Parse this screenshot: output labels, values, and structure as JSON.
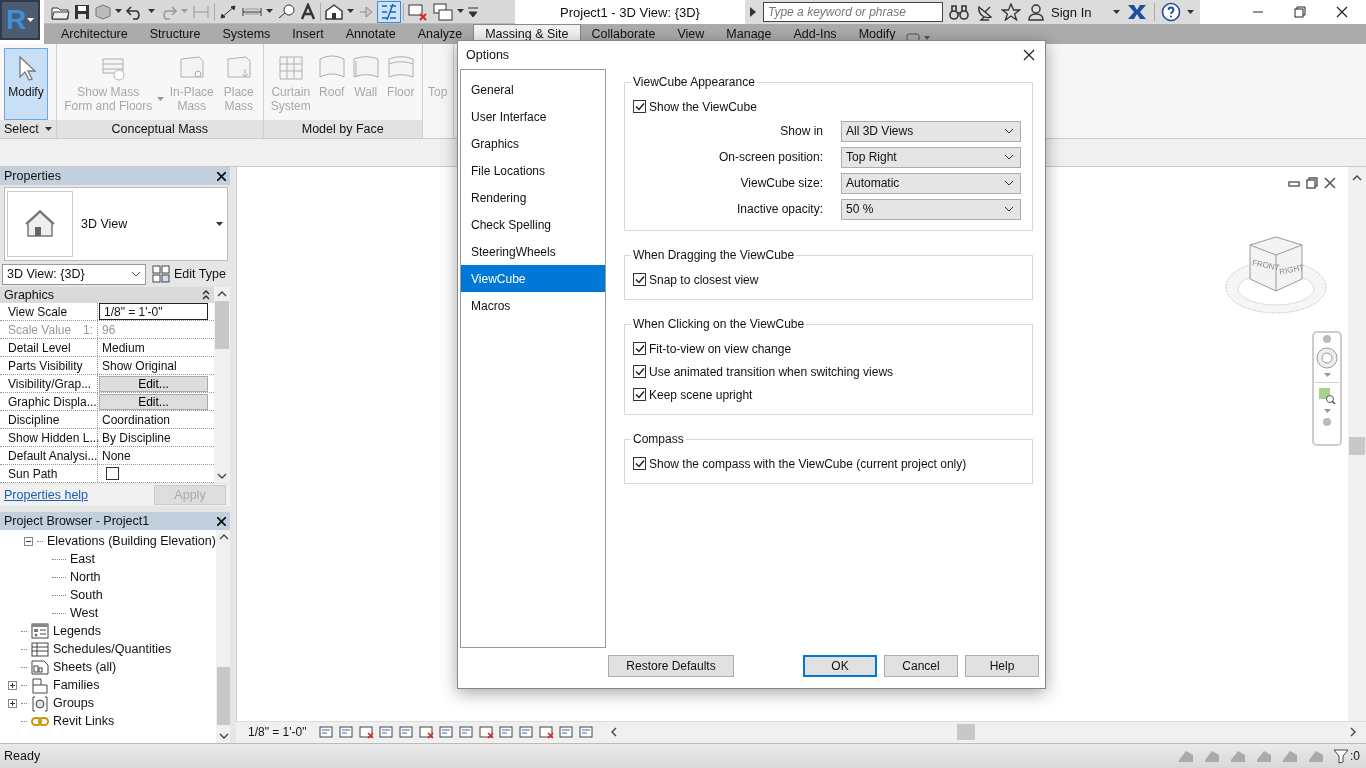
{
  "app_button": {
    "label": "R"
  },
  "window": {
    "title": "Project1 - 3D View: {3D}"
  },
  "search": {
    "placeholder": "Type a keyword or phrase"
  },
  "account": {
    "label": "Sign In"
  },
  "ribbon_tabs": [
    {
      "label": "Architecture",
      "selected": false
    },
    {
      "label": "Structure",
      "selected": false
    },
    {
      "label": "Systems",
      "selected": false
    },
    {
      "label": "Insert",
      "selected": false
    },
    {
      "label": "Annotate",
      "selected": false
    },
    {
      "label": "Analyze",
      "selected": false
    },
    {
      "label": "Massing & Site",
      "selected": true
    },
    {
      "label": "Collaborate",
      "selected": false
    },
    {
      "label": "View",
      "selected": false
    },
    {
      "label": "Manage",
      "selected": false
    },
    {
      "label": "Add-Ins",
      "selected": false
    },
    {
      "label": "Modify",
      "selected": false
    }
  ],
  "ribbon_panels": [
    {
      "label": "Select",
      "menu": true,
      "buttons": [
        {
          "label": "Modify",
          "selected": true,
          "disabled": false,
          "menu": false
        }
      ]
    },
    {
      "label": "Conceptual Mass",
      "menu": false,
      "buttons": [
        {
          "label": "Show Mass Form and Floors",
          "selected": false,
          "disabled": true,
          "menu": true
        },
        {
          "label": "In-Place Mass",
          "selected": false,
          "disabled": true,
          "menu": false
        },
        {
          "label": "Place Mass",
          "selected": false,
          "disabled": true,
          "menu": false
        }
      ]
    },
    {
      "label": "Model by Face",
      "menu": false,
      "buttons": [
        {
          "label": "Curtain System",
          "selected": false,
          "disabled": true,
          "menu": false
        },
        {
          "label": "Roof",
          "selected": false,
          "disabled": true,
          "menu": false
        },
        {
          "label": "Wall",
          "selected": false,
          "disabled": true,
          "menu": false
        },
        {
          "label": "Floor",
          "selected": false,
          "disabled": true,
          "menu": false
        }
      ]
    },
    {
      "buttons": [
        {
          "label": "Top",
          "selected": false,
          "disabled": true,
          "menu": false
        }
      ]
    }
  ],
  "properties": {
    "title": "Properties",
    "type_name": "3D View",
    "instance": "3D View: {3D}",
    "edit_type": "Edit Type",
    "group": {
      "label": "Graphics",
      "expanded": true
    },
    "rows": [
      {
        "kind": "input",
        "label": "View Scale",
        "value": "1/8\" = 1'-0\""
      },
      {
        "kind": "readonly",
        "label": "Scale Value",
        "unit": "1:",
        "value": "96"
      },
      {
        "kind": "text",
        "label": "Detail Level",
        "value": "Medium"
      },
      {
        "kind": "text",
        "label": "Parts Visibility",
        "value": "Show Original"
      },
      {
        "kind": "button",
        "label": "Visibility/Grap...",
        "value": "Edit..."
      },
      {
        "kind": "button",
        "label": "Graphic Displa...",
        "value": "Edit..."
      },
      {
        "kind": "text",
        "label": "Discipline",
        "value": "Coordination"
      },
      {
        "kind": "text",
        "label": "Show Hidden L...",
        "value": "By Discipline"
      },
      {
        "kind": "text",
        "label": "Default Analysi...",
        "value": "None"
      },
      {
        "kind": "checkbox",
        "label": "Sun Path",
        "checked": false
      }
    ],
    "help": "Properties help",
    "apply": {
      "label": "Apply",
      "disabled": true
    }
  },
  "project_browser": {
    "title": "Project Browser - Project1",
    "items": [
      {
        "label": "Elevations (Building Elevation)",
        "expanded": true,
        "children": [
          {
            "label": "East"
          },
          {
            "label": "North"
          },
          {
            "label": "South"
          },
          {
            "label": "West"
          }
        ]
      },
      {
        "label": "Legends"
      },
      {
        "label": "Schedules/Quantities"
      },
      {
        "label": "Sheets (all)"
      },
      {
        "label": "Families",
        "expanded": false
      },
      {
        "label": "Groups",
        "expanded": false
      },
      {
        "label": "Revit Links"
      }
    ]
  },
  "view": {
    "scale": "1/8\" = 1'-0\"",
    "viewcube_faces": [
      "FRONT",
      "RIGHT"
    ]
  },
  "status_bar": {
    "text": "Ready",
    "filter_count": ":0"
  },
  "dialog": {
    "title": "Options",
    "nav": [
      {
        "label": "General",
        "selected": false
      },
      {
        "label": "User Interface",
        "selected": false
      },
      {
        "label": "Graphics",
        "selected": false
      },
      {
        "label": "File Locations",
        "selected": false
      },
      {
        "label": "Rendering",
        "selected": false
      },
      {
        "label": "Check Spelling",
        "selected": false
      },
      {
        "label": "SteeringWheels",
        "selected": false
      },
      {
        "label": "ViewCube",
        "selected": true
      },
      {
        "label": "Macros",
        "selected": false
      }
    ],
    "groups": [
      {
        "title": "ViewCube Appearance",
        "rows": [
          {
            "kind": "checkbox",
            "label": "Show the ViewCube",
            "checked": true
          },
          {
            "kind": "select",
            "label": "Show in",
            "value": "All 3D Views"
          },
          {
            "kind": "select",
            "label": "On-screen position:",
            "value": "Top Right"
          },
          {
            "kind": "select",
            "label": "ViewCube size:",
            "value": "Automatic"
          },
          {
            "kind": "select",
            "label": "Inactive opacity:",
            "value": "50 %"
          }
        ]
      },
      {
        "title": "When Dragging the ViewCube",
        "rows": [
          {
            "kind": "checkbox",
            "label": "Snap to closest view",
            "checked": true
          }
        ]
      },
      {
        "title": "When Clicking on the ViewCube",
        "rows": [
          {
            "kind": "checkbox",
            "label": "Fit-to-view on view change",
            "checked": true
          },
          {
            "kind": "checkbox",
            "label": "Use animated transition when switching views",
            "checked": true
          },
          {
            "kind": "checkbox",
            "label": "Keep scene upright",
            "checked": true
          }
        ]
      },
      {
        "title": "Compass",
        "rows": [
          {
            "kind": "checkbox",
            "label": "Show the compass with the ViewCube (current project only)",
            "checked": true
          }
        ]
      }
    ],
    "buttons": [
      {
        "label": "Restore Defaults",
        "default": false
      },
      {
        "label": "OK",
        "default": true
      },
      {
        "label": "Cancel",
        "default": false
      },
      {
        "label": "Help",
        "default": false
      }
    ]
  }
}
